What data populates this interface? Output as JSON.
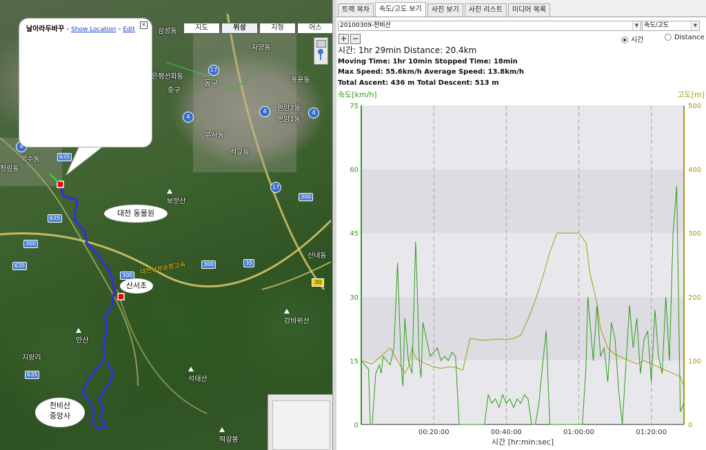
{
  "map": {
    "tabs": [
      "지도",
      "위성",
      "지형",
      "어스"
    ],
    "active_tab": "위성",
    "infowindow": {
      "title": "날아라두바꾸",
      "separator1": " - ",
      "show_location": "Show Location",
      "separator2": " - ",
      "edit": "Edit",
      "close": "×"
    },
    "bubbles": [
      "대전 동물원",
      "산서초",
      "천비산",
      "중앙사"
    ],
    "places": [
      "삼성동",
      "자양동",
      "은평선화동",
      "중구",
      "동구",
      "용운동",
      "판암2동",
      "판암1동",
      "부사동",
      "석교동",
      "정림동",
      "북수동",
      "보문산",
      "산내동",
      "강바위산",
      "안산",
      "지랑리",
      "석태산",
      "떡갈봉"
    ],
    "road_label": "대전남부순환고속",
    "route_numbers": [
      "17",
      "4",
      "4",
      "4",
      "4",
      "635",
      "635",
      "635",
      "635",
      "300",
      "300",
      "300",
      "300",
      "35",
      "17",
      "30"
    ],
    "route_color": "#3030e0"
  },
  "panel": {
    "tabs": [
      "트랙 목차",
      "속도/고도 보기",
      "사진 보기",
      "사진 리스트",
      "미디어 목록"
    ],
    "active_tab": "속도/고도 보기",
    "track_select": "20100309-천비산",
    "mode_select": "속도/고도",
    "zoom_in": "+",
    "zoom_out": "−",
    "radio_time": "시간",
    "radio_distance": "Distance",
    "radio_selected": "시간",
    "stats": {
      "line1": "시간: 1hr 29min  Distance: 20.4km",
      "line2": "Moving Time: 1hr 10min  Stopped Time: 18min",
      "line3": "Max Speed: 55.6km/h  Average Speed: 13.8km/h",
      "line4": "Total Ascent: 436 m  Total Descent: 513 m"
    }
  },
  "chart_data": {
    "type": "line",
    "ylabel_left": "속도[km/h]",
    "ylabel_right": "고도[m]",
    "xlabel": "시간 [hr:min:sec]",
    "ylim_left": [
      0,
      75
    ],
    "ylim_right": [
      0,
      500
    ],
    "yticks_left": [
      "0",
      "15",
      "30",
      "45",
      "60",
      "75"
    ],
    "yticks_right": [
      "0",
      "100",
      "200",
      "300",
      "400",
      "500"
    ],
    "xlim_min": [
      0,
      89
    ],
    "xticks": [
      "00:20:00",
      "00:40:00",
      "01:00:00",
      "01:20:00"
    ],
    "xtick_min": [
      20,
      40,
      60,
      80
    ],
    "grid": true,
    "speed_color": "#2e9a1a",
    "altitude_color": "#a69a10",
    "series": [
      {
        "name": "속도",
        "x": [
          0,
          1,
          2,
          2.5,
          3,
          4,
          5,
          5.5,
          6,
          7,
          8,
          9,
          10,
          11,
          11.5,
          12,
          13,
          14,
          15,
          15.5,
          16,
          16.5,
          17,
          18,
          19,
          20,
          21,
          22,
          23,
          24,
          25,
          26,
          27,
          28,
          29,
          30,
          31,
          32,
          33,
          34,
          35,
          36,
          37,
          38,
          39,
          40,
          41,
          42,
          43,
          44,
          45,
          46,
          47,
          48,
          49,
          50,
          51,
          52,
          53,
          54,
          55,
          56,
          57,
          58,
          59,
          60,
          61,
          62,
          62.5,
          63,
          64,
          65,
          66,
          67,
          68,
          69,
          70,
          71,
          72,
          73,
          74,
          75,
          76,
          77,
          78,
          79,
          80,
          81,
          82,
          83,
          84,
          85,
          86,
          87,
          88,
          89
        ],
        "y": [
          15,
          14,
          13,
          0,
          0,
          12,
          14,
          12,
          16,
          15,
          14,
          18,
          38,
          14,
          9,
          25,
          15,
          12,
          43,
          30,
          15,
          11,
          24,
          20,
          16,
          17,
          18,
          15,
          16,
          15,
          17,
          16,
          0,
          0,
          0,
          0,
          0,
          0,
          0,
          0,
          7,
          5,
          6,
          4,
          7,
          5,
          6,
          4,
          6,
          5,
          7,
          6,
          0,
          0,
          5,
          14,
          22,
          0,
          0,
          0,
          0,
          0,
          0,
          0,
          0,
          0,
          0,
          14,
          30,
          25,
          15,
          28,
          16,
          18,
          10,
          24,
          20,
          8,
          0,
          14,
          28,
          18,
          25,
          12,
          20,
          22,
          10,
          27,
          16,
          12,
          30,
          15,
          45,
          56,
          3,
          5
        ]
      },
      {
        "name": "고도",
        "x": [
          0,
          3,
          6,
          8,
          10,
          11,
          12,
          13,
          14,
          15,
          16,
          18,
          20,
          22,
          24,
          26,
          28,
          30,
          32,
          34,
          36,
          38,
          40,
          42,
          44,
          46,
          48,
          50,
          52,
          54,
          56,
          58,
          60,
          62,
          63,
          64,
          65,
          66,
          68,
          70,
          72,
          74,
          76,
          78,
          80,
          82,
          84,
          86,
          88,
          89
        ],
        "y": [
          100,
          95,
          110,
          120,
          100,
          90,
          80,
          90,
          120,
          105,
          100,
          95,
          90,
          88,
          90,
          90,
          85,
          135,
          133,
          132,
          133,
          134,
          133,
          135,
          140,
          165,
          195,
          230,
          270,
          300,
          300,
          300,
          300,
          285,
          240,
          215,
          190,
          150,
          120,
          110,
          105,
          100,
          95,
          100,
          95,
          90,
          85,
          80,
          75,
          60
        ]
      }
    ]
  }
}
